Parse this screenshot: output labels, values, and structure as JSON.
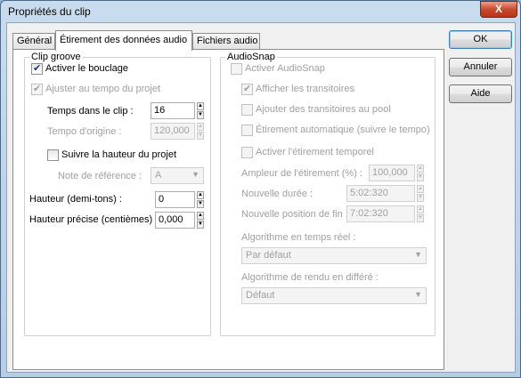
{
  "window": {
    "title": "Propriétés du clip",
    "close_label": "X"
  },
  "tabs": [
    {
      "label": "Général"
    },
    {
      "label": "Étirement des données audio"
    },
    {
      "label": "Fichiers audio"
    }
  ],
  "clip_groove": {
    "label": "Clip groove",
    "loop": {
      "label": "Activer le bouclage",
      "checked": true
    },
    "adjust_tempo": {
      "label": "Ajuster au tempo du projet",
      "checked": true
    },
    "time_in_clip": {
      "label": "Temps dans le clip :",
      "value": "16"
    },
    "original_tempo": {
      "label": "Tempo d'origine :",
      "value": "120,000"
    },
    "follow_pitch": {
      "label": "Suivre la hauteur du projet",
      "checked": false
    },
    "reference_note": {
      "label": "Note de référence :",
      "value": "A"
    },
    "pitch": {
      "label": "Hauteur (demi-tons) :",
      "value": "0"
    },
    "fine_pitch": {
      "label": "Hauteur précise (centièmes) :",
      "value": "0,000"
    }
  },
  "audiosnap": {
    "label": "AudioSnap",
    "enable": {
      "label": "Activer AudioSnap",
      "checked": false
    },
    "show_transients": {
      "label": "Afficher les transitoires",
      "checked": true
    },
    "add_to_pool": {
      "label": "Ajouter des transitoires au pool",
      "checked": false
    },
    "auto_stretch": {
      "label": "Étirement automatique (suivre le tempo)",
      "checked": false
    },
    "temporal_stretch": {
      "label": "Activer l'étirement temporel",
      "checked": false
    },
    "stretch_amount": {
      "label": "Ampleur de l'étirement (%) :",
      "value": "100,000"
    },
    "new_duration": {
      "label": "Nouvelle durée :",
      "value": "5:02:320"
    },
    "new_end": {
      "label": "Nouvelle position de fin :",
      "value": "7:02:320"
    },
    "realtime_algo": {
      "label": "Algorithme en temps réel :",
      "value": "Par défaut"
    },
    "offline_algo": {
      "label": "Algorithme de rendu en différé :",
      "value": "Défaut"
    }
  },
  "buttons": {
    "ok": "OK",
    "cancel": "Annuler",
    "help": "Aide"
  }
}
